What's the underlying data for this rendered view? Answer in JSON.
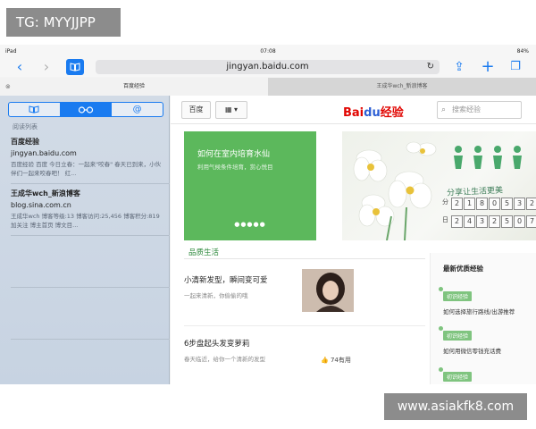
{
  "overlay": {
    "tg_badge": "TG: MYYJJPP",
    "watermark": "www.asiakfk8.com"
  },
  "status_bar": {
    "device": "iPad",
    "time": "07:08",
    "battery": "84%"
  },
  "toolbar": {
    "back_glyph": "‹",
    "forward_glyph": "›",
    "bookmarks_icon": "book-icon",
    "url": "jingyan.baidu.com",
    "reload_glyph": "↻",
    "share_glyph": "⇪",
    "new_tab_glyph": "+",
    "tabs_glyph": "❐"
  },
  "tabs": [
    {
      "label": "百度经验",
      "active": true
    },
    {
      "label": "王成华wch_新浪博客",
      "active": false
    }
  ],
  "sidebar": {
    "segments": [
      {
        "icon": "book-icon",
        "glyph": "📖",
        "selected": false
      },
      {
        "icon": "glasses-icon",
        "glyph": "∞",
        "selected": true
      },
      {
        "icon": "at-icon",
        "glyph": "@",
        "selected": false
      }
    ],
    "section_title": "阅读列表",
    "items": [
      {
        "title": "百度经验",
        "url": "jingyan.baidu.com",
        "desc": "百度经验 百度 今日立春：一起来\"咬春\" 春天已到来，小伙伴们一起来咬春吧！ 红..."
      },
      {
        "title": "王成华wch_新浪博客",
        "url": "blog.sina.com.cn",
        "desc": "王成华wch 博客等级:13 博客访问:25,456 博客积分:819 加关注 博主首页 博文目..."
      }
    ]
  },
  "webpage": {
    "btn_baidu": "百度",
    "btn_grid_glyph": "▦ ▾",
    "logo_bai": "Bai",
    "logo_du": "du",
    "logo_suffix": "经验",
    "search_placeholder": "搜索经验",
    "green_card": {
      "title": "如何在室内培育水仙",
      "subtitle": "利用气候条件培育，赏心悦目",
      "dots": "●●●●●"
    },
    "banner": {
      "slogan": "分享让生活更美",
      "row1_label": "分",
      "row1": [
        "2",
        "1",
        "8",
        "0",
        "5",
        "3",
        "2"
      ],
      "row2_label": "日",
      "row2": [
        "2",
        "4",
        "3",
        "2",
        "5",
        "0",
        "7"
      ]
    },
    "section_title": "品质生活",
    "articles": [
      {
        "title": "小清新发型，瞬间变可爱",
        "sub": "一起来清新，你偷偷的哦"
      },
      {
        "title": "6步盘起头发变萝莉",
        "sub": "春天临近，给你一个清新的发型",
        "useful": "74有用"
      }
    ],
    "right_col": {
      "title": "最新优质经验",
      "items": [
        {
          "tag": "初识经验",
          "text": "如何选择旅行路线/出游推荐"
        },
        {
          "tag": "初识经验",
          "text": "如何用微信零钱充话费"
        },
        {
          "tag": "初识经验",
          "text": ""
        }
      ]
    }
  }
}
